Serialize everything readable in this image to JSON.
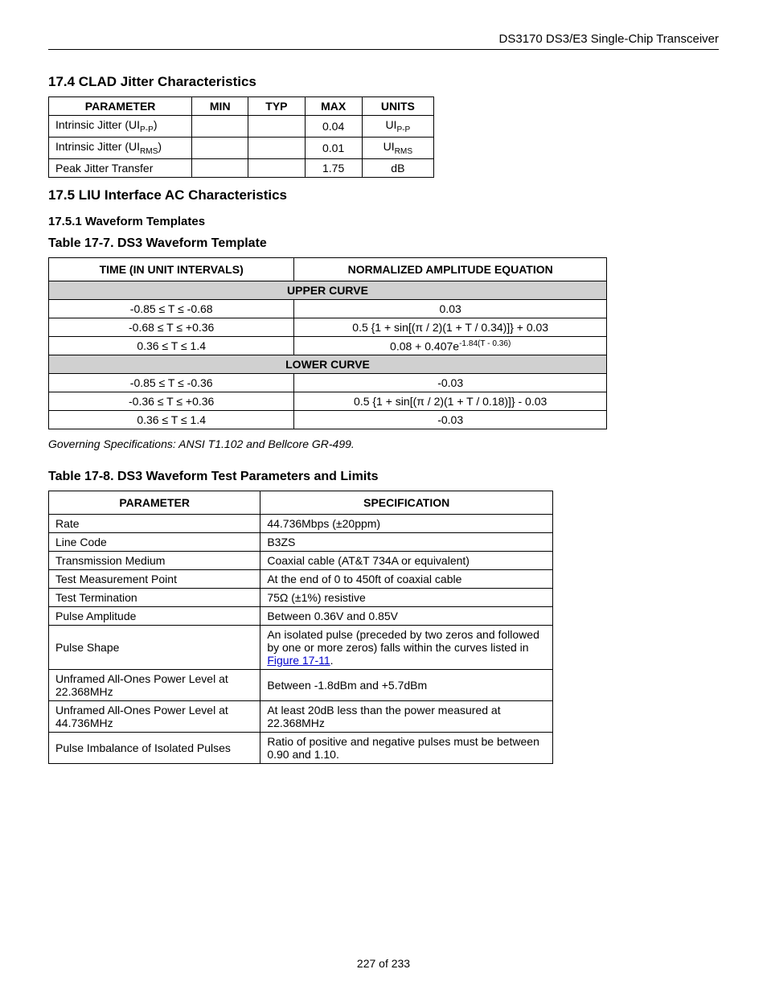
{
  "header": "DS3170 DS3/E3 Single-Chip Transceiver",
  "sec174": {
    "title": "17.4  CLAD Jitter Characteristics",
    "cols": [
      "PARAMETER",
      "MIN",
      "TYP",
      "MAX",
      "UNITS"
    ],
    "rows": [
      {
        "param_html": "Intrinsic Jitter (UI<sub>P-P</sub>)",
        "min": "",
        "typ": "",
        "max": "0.04",
        "units_html": "UI<sub>P-P</sub>"
      },
      {
        "param_html": "Intrinsic Jitter (UI<sub>RMS</sub>)",
        "min": "",
        "typ": "",
        "max": "0.01",
        "units_html": "UI<sub>RMS</sub>"
      },
      {
        "param_html": "Peak Jitter Transfer",
        "min": "",
        "typ": "",
        "max": "1.75",
        "units_html": "dB"
      }
    ]
  },
  "sec175": {
    "title": "17.5  LIU Interface AC Characteristics",
    "sub1751": "17.5.1  Waveform Templates"
  },
  "table177": {
    "title": "Table 17-7. DS3 Waveform Template",
    "cols": [
      "TIME (IN UNIT INTERVALS)",
      "NORMALIZED AMPLITUDE EQUATION"
    ],
    "upper_label": "UPPER CURVE",
    "upper_rows": [
      {
        "t": "-0.85 ≤ T ≤ -0.68",
        "eq_html": "0.03"
      },
      {
        "t": "-0.68 ≤ T ≤ +0.36",
        "eq_html": "0.5 {1 + sin[(π / 2)(1 + T / 0.34)]} + 0.03"
      },
      {
        "t": "0.36 ≤ T ≤ 1.4",
        "eq_html": "0.08 + 0.407e<sup>-1.84(T - 0.36)</sup>"
      }
    ],
    "lower_label": "LOWER CURVE",
    "lower_rows": [
      {
        "t": "-0.85 ≤ T ≤ -0.36",
        "eq_html": "-0.03"
      },
      {
        "t": "-0.36 ≤ T ≤ +0.36",
        "eq_html": "0.5 {1 + sin[(π / 2)(1 + T / 0.18)]} - 0.03"
      },
      {
        "t": "0.36 ≤ T ≤ 1.4",
        "eq_html": "-0.03"
      }
    ],
    "note": "Governing Specifications: ANSI T1.102 and Bellcore GR-499."
  },
  "table178": {
    "title": "Table 17-8. DS3 Waveform Test Parameters and Limits",
    "cols": [
      "PARAMETER",
      "SPECIFICATION"
    ],
    "rows": [
      {
        "p": "Rate",
        "s_html": "44.736Mbps (±20ppm)"
      },
      {
        "p": "Line Code",
        "s_html": "B3ZS"
      },
      {
        "p": "Transmission Medium",
        "s_html": "Coaxial cable (AT&T 734A or equivalent)"
      },
      {
        "p": "Test Measurement Point",
        "s_html": "At the end of 0 to 450ft of coaxial cable"
      },
      {
        "p": "Test Termination",
        "s_html": "75Ω (±1%) resistive"
      },
      {
        "p": "Pulse Amplitude",
        "s_html": "Between 0.36V and 0.85V"
      },
      {
        "p": "Pulse Shape",
        "s_html": "An isolated pulse (preceded by two zeros and followed by one or more zeros) falls within the curves listed in <a class=\"link\" href=\"#\">Figure 17-11</a>."
      },
      {
        "p": "Unframed All-Ones Power Level at 22.368MHz",
        "s_html": "Between -1.8dBm and +5.7dBm"
      },
      {
        "p": "Unframed All-Ones Power Level at 44.736MHz",
        "s_html": "At least 20dB less than the power measured at 22.368MHz"
      },
      {
        "p": "Pulse Imbalance of Isolated Pulses",
        "s_html": "Ratio of positive and negative pulses must be between 0.90 and 1.10."
      }
    ]
  },
  "footer": "227 of 233"
}
